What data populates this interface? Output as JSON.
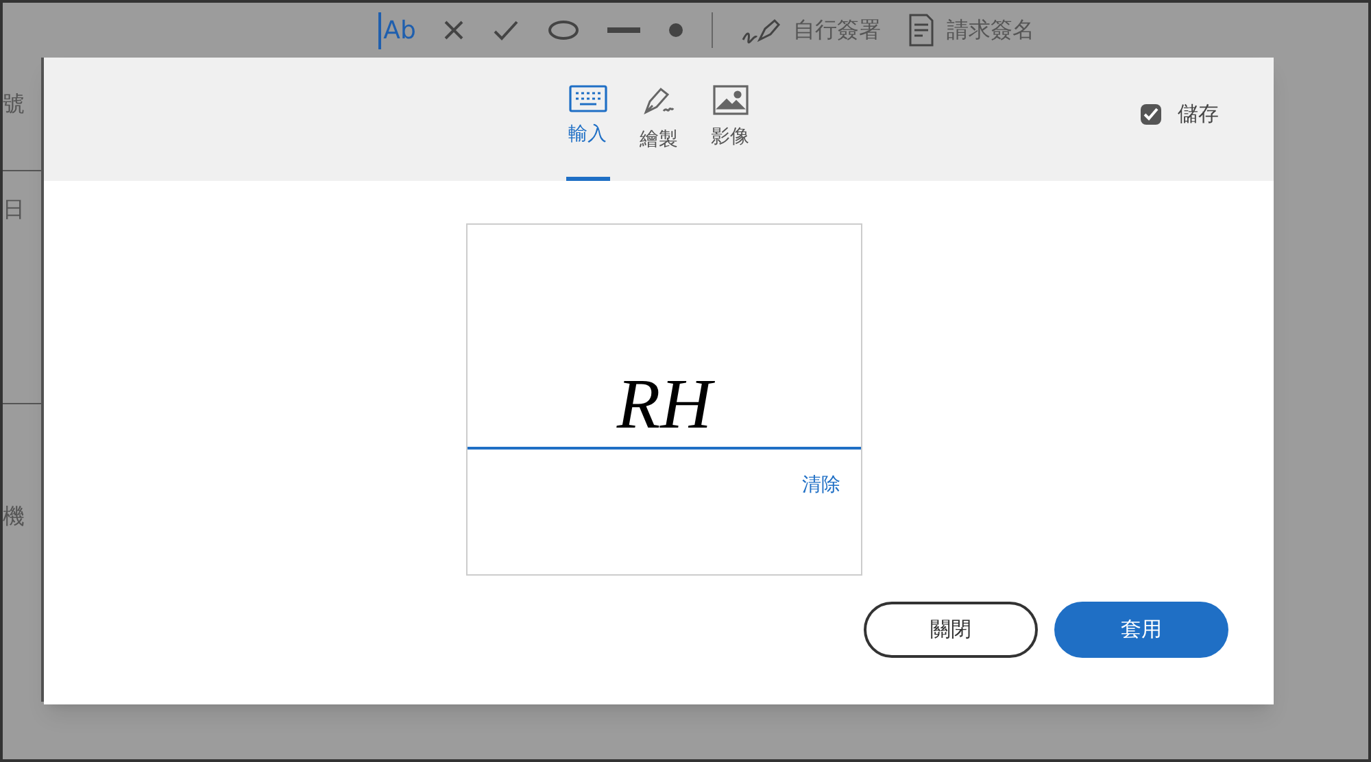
{
  "document": {
    "toolbar": {
      "text_tool": "Ab",
      "actions": [
        "自行簽署",
        "請求簽名"
      ]
    },
    "row_labels": [
      "號",
      "日",
      "機"
    ]
  },
  "dialog": {
    "tabs": [
      {
        "label": "輸入",
        "kind": "keyboard",
        "selected": true
      },
      {
        "label": "繪製",
        "kind": "pen",
        "selected": false
      },
      {
        "label": "影像",
        "kind": "image",
        "selected": false
      }
    ],
    "save": {
      "label": "儲存",
      "checked": true
    },
    "signature": {
      "value": "RH",
      "clear": "清除"
    },
    "buttons": [
      {
        "label": "關閉",
        "kind": "secondary"
      },
      {
        "label": "套用",
        "kind": "primary"
      }
    ]
  }
}
